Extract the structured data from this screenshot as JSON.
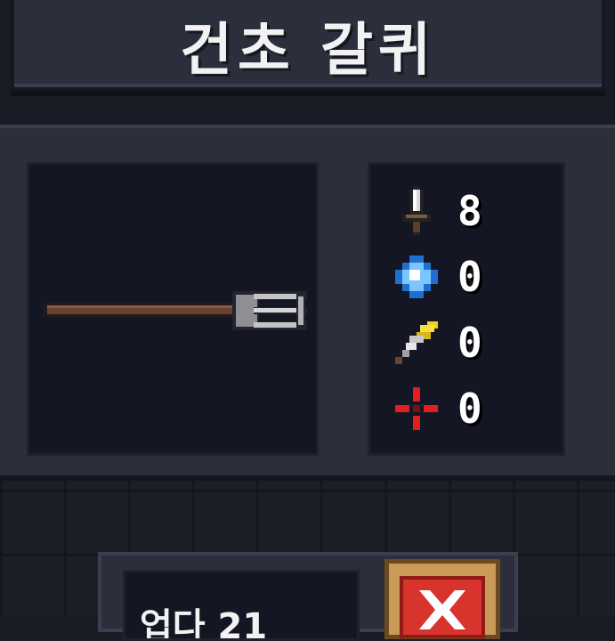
{
  "title": "건초 갈퀴",
  "weapon": {
    "name": "pitchfork",
    "stats": [
      {
        "icon": "damage-sword-icon",
        "value": "8"
      },
      {
        "icon": "energy-crystal-icon",
        "value": "0"
      },
      {
        "icon": "critical-feather-icon",
        "value": "0"
      },
      {
        "icon": "accuracy-crosshair-icon",
        "value": "0"
      }
    ]
  },
  "footer": {
    "level_label": "업다 21"
  },
  "colors": {
    "panel": "#2b2e3b",
    "inset": "#141624",
    "close_button": "#d8342d",
    "close_frame": "#c99a58"
  }
}
